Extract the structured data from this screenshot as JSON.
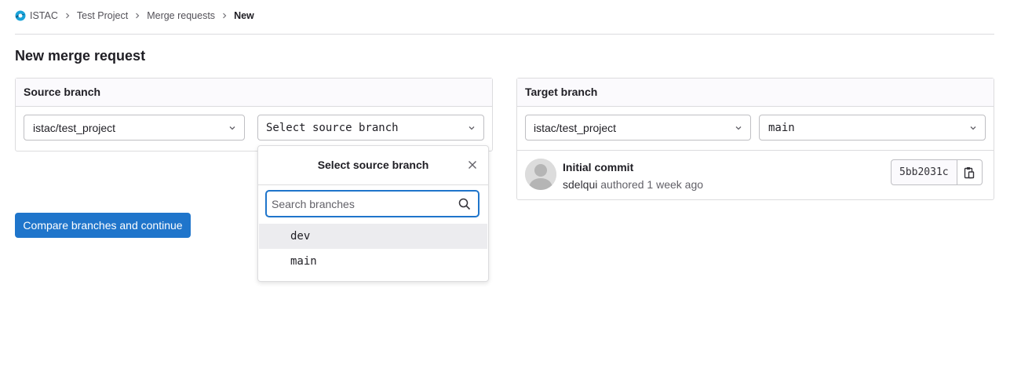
{
  "breadcrumb": {
    "items": [
      "ISTAC",
      "Test Project",
      "Merge requests"
    ],
    "current": "New"
  },
  "page": {
    "title": "New merge request"
  },
  "source": {
    "header": "Source branch",
    "project": "istac/test_project",
    "branch_placeholder": "Select source branch"
  },
  "target": {
    "header": "Target branch",
    "project": "istac/test_project",
    "branch": "main",
    "commit": {
      "title": "Initial commit",
      "author": "sdelqui",
      "meta": "authored 1 week ago",
      "sha": "5bb2031c"
    }
  },
  "compare_button": "Compare branches and continue",
  "dropdown": {
    "title": "Select source branch",
    "search_placeholder": "Search branches",
    "items": [
      "dev",
      "main"
    ]
  },
  "colors": {
    "primary": "#1f75cb",
    "highlight": "#ececef",
    "border": "#dcdcde"
  }
}
